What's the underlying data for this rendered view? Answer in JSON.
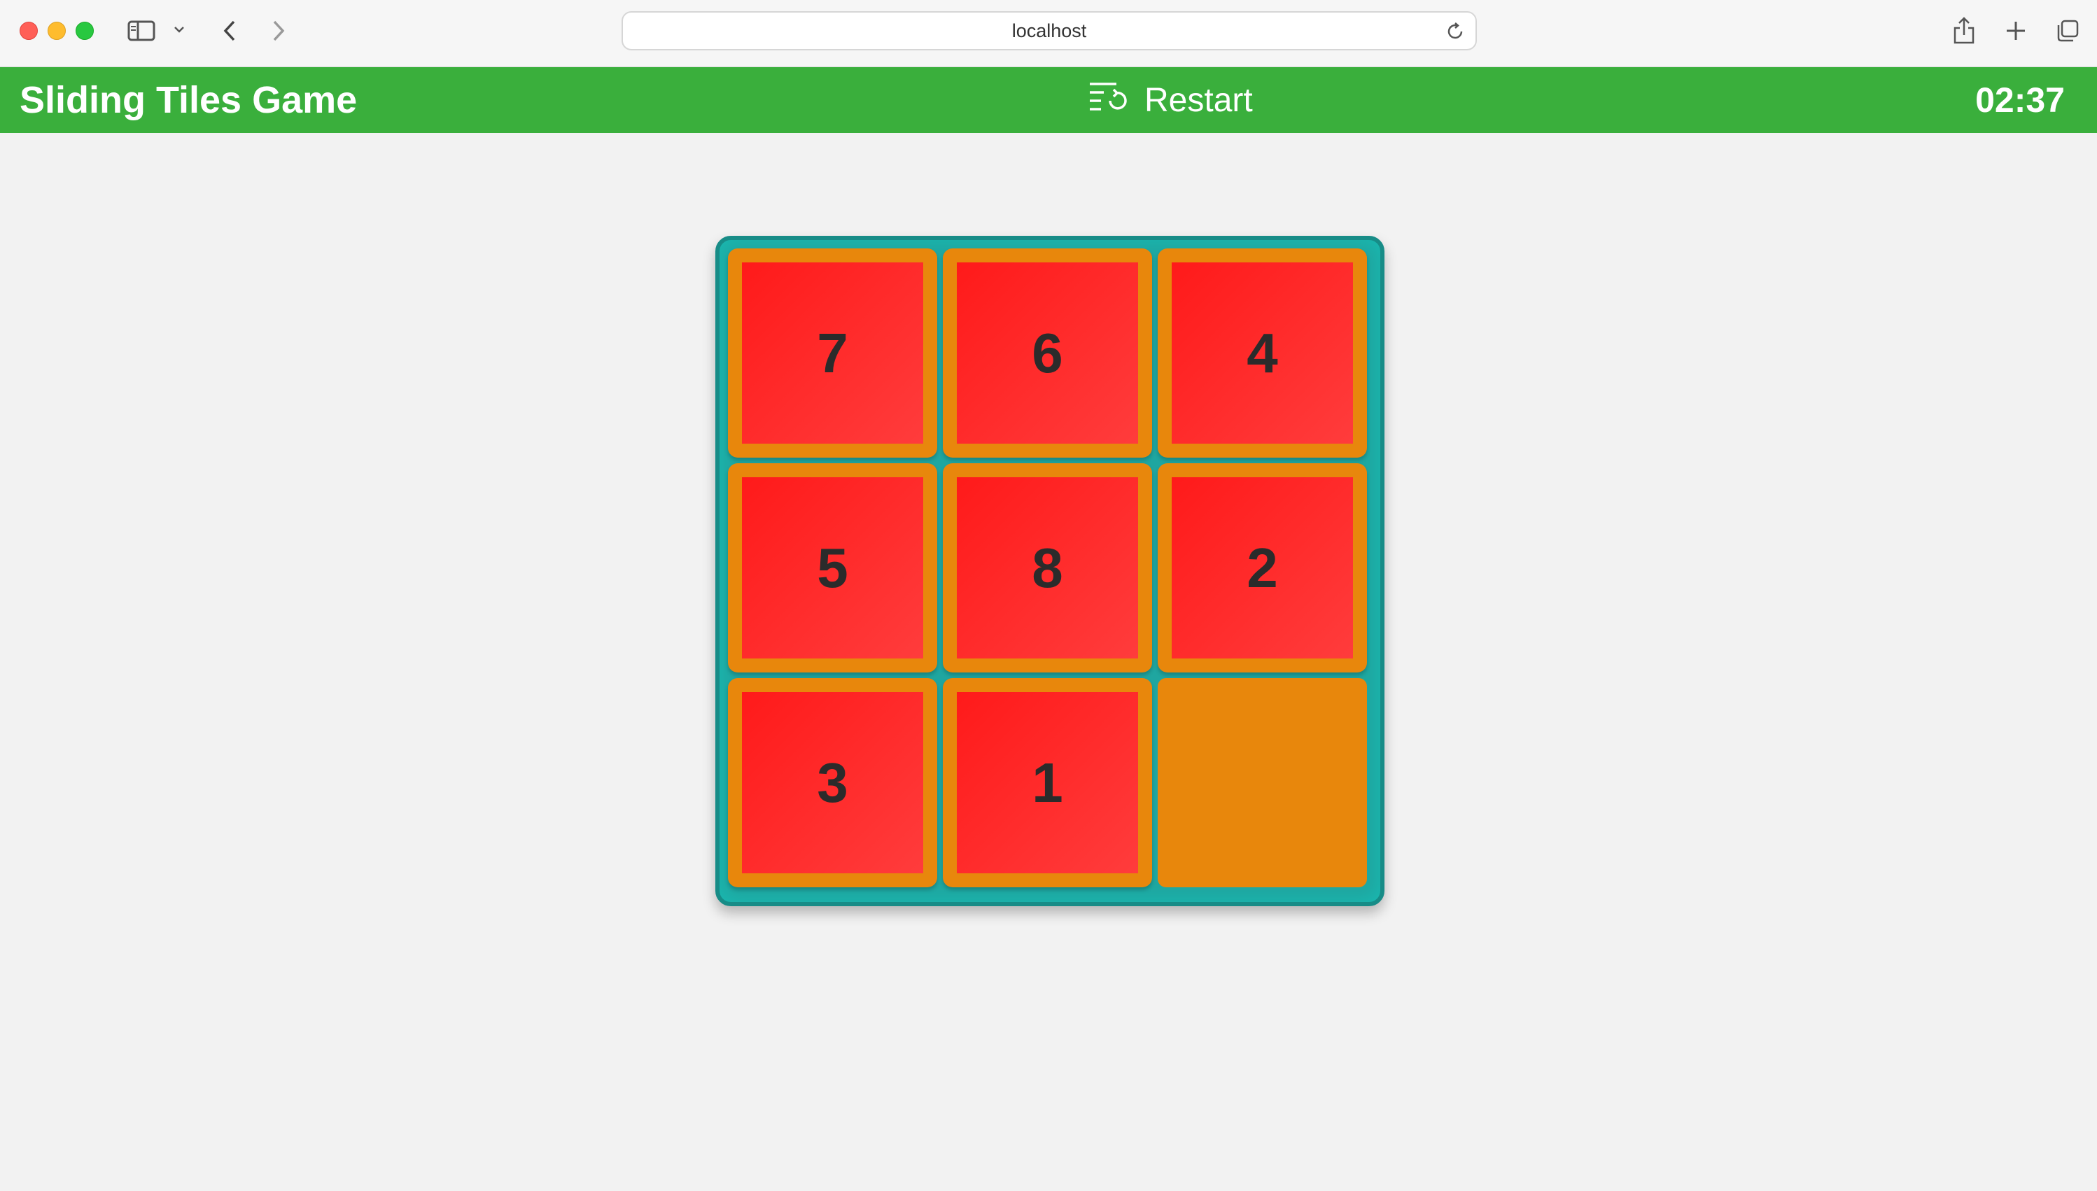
{
  "browser": {
    "url": "localhost"
  },
  "header": {
    "title": "Sliding Tiles Game",
    "restart_label": "Restart",
    "timer": "02:37",
    "bg_color": "#3aaf3c"
  },
  "board": {
    "rows": 3,
    "cols": 3,
    "tiles": [
      "7",
      "6",
      "4",
      "5",
      "8",
      "2",
      "3",
      "1",
      ""
    ],
    "colors": {
      "board": "#1fa6a0",
      "tile_frame": "#e8870c",
      "tile_face": "#ff1a1a",
      "number": "#2b2b2b"
    }
  }
}
